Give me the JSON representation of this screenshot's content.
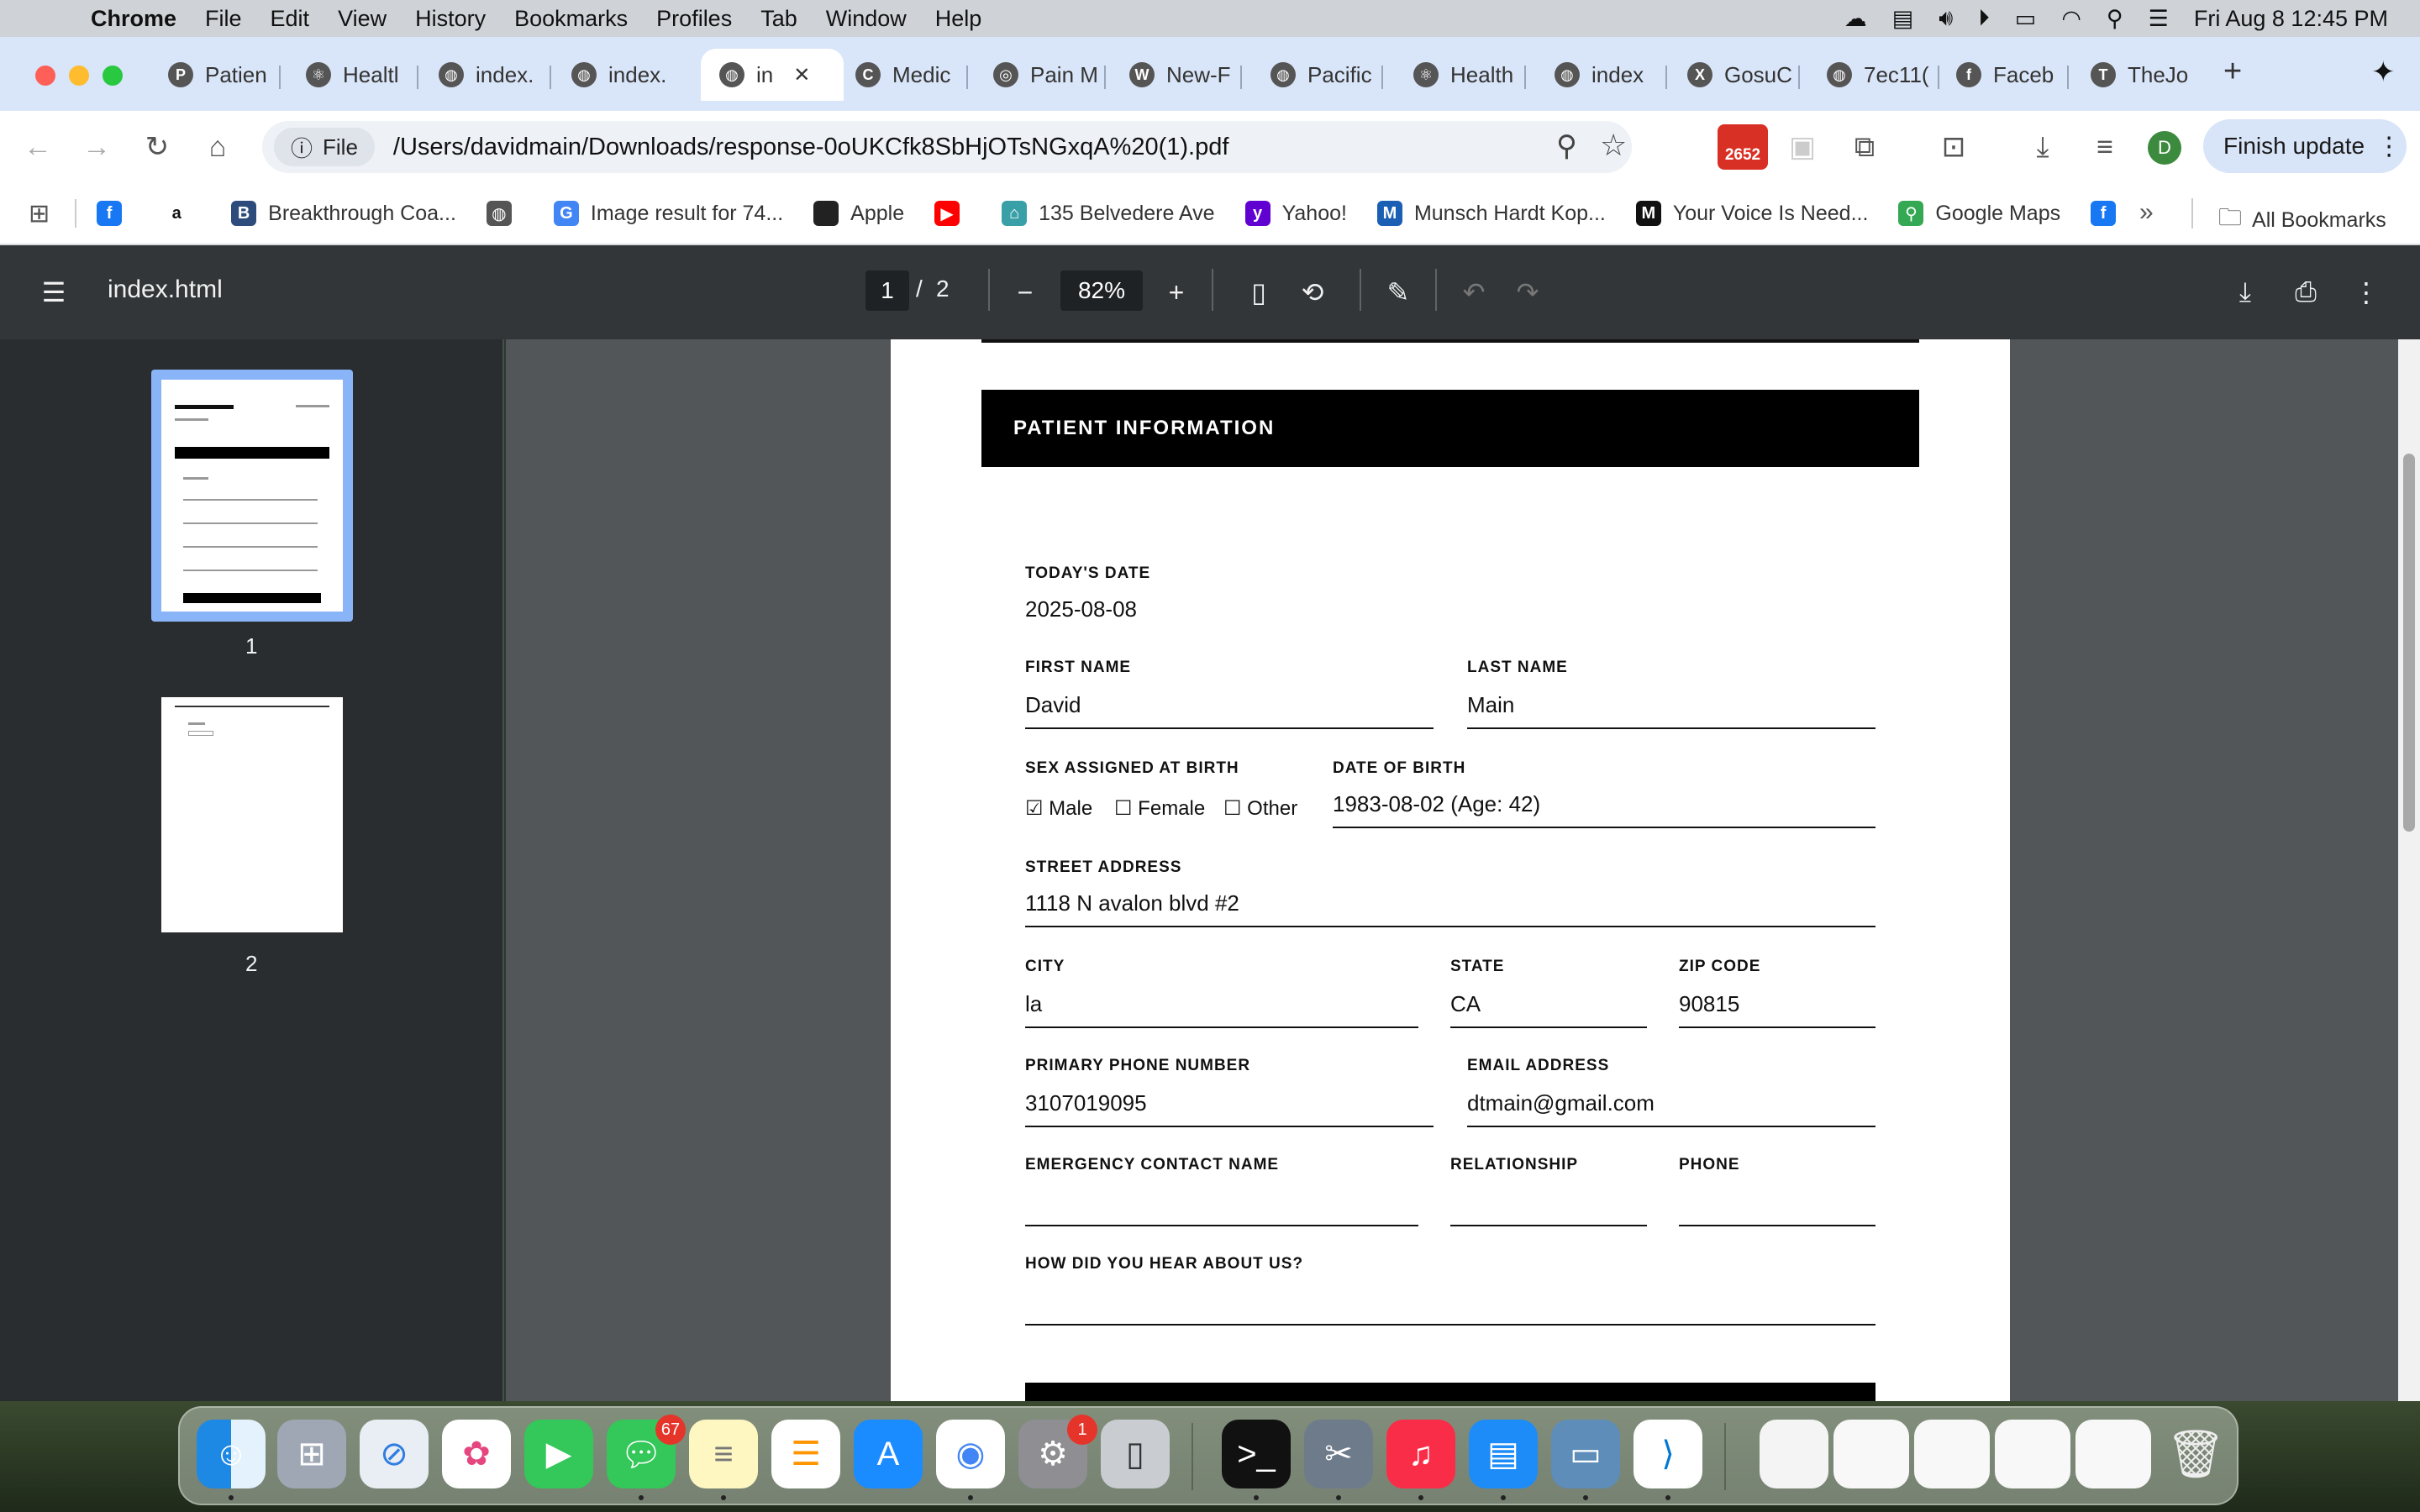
{
  "menubar": {
    "app": "Chrome",
    "items": [
      "File",
      "Edit",
      "View",
      "History",
      "Bookmarks",
      "Profiles",
      "Tab",
      "Window",
      "Help"
    ],
    "datetime": "Fri Aug 8  12:45 PM"
  },
  "tabs": [
    {
      "label": "Patien",
      "icon": "P"
    },
    {
      "label": "Healtl",
      "icon": "⚛"
    },
    {
      "label": "index.",
      "icon": "◍"
    },
    {
      "label": "index.",
      "icon": "◍"
    },
    {
      "label": "in",
      "icon": "◍",
      "active": true
    },
    {
      "label": "Medic",
      "icon": "C"
    },
    {
      "label": "Pain M",
      "icon": "◎"
    },
    {
      "label": "New-F",
      "icon": "W"
    },
    {
      "label": "Pacific",
      "icon": "◍"
    },
    {
      "label": "Health",
      "icon": "⚛"
    },
    {
      "label": "index",
      "icon": "◍"
    },
    {
      "label": "GosuC",
      "icon": "X"
    },
    {
      "label": "7ec11(",
      "icon": "◍"
    },
    {
      "label": "Faceb",
      "icon": "f"
    },
    {
      "label": "TheJo",
      "icon": "T"
    }
  ],
  "toolbar": {
    "file_chip": "File",
    "url": "/Users/davidmain/Downloads/response-0oUKCfk8SbHjOTsNGxqA%20(1).pdf",
    "badge_count": "2652",
    "profile_initial": "D",
    "finish_update": "Finish update"
  },
  "bookmarks": [
    {
      "label": "",
      "icon": "f",
      "color": "#1877f2"
    },
    {
      "label": "",
      "icon": "a",
      "color": "#ffffff"
    },
    {
      "label": "Breakthrough Coa...",
      "icon": "B",
      "color": "#2d4c7c"
    },
    {
      "label": "",
      "icon": "◍",
      "color": "#555555"
    },
    {
      "label": "Image result for 74...",
      "icon": "G",
      "color": "#4285f4"
    },
    {
      "label": "Apple",
      "icon": "",
      "color": "#222222"
    },
    {
      "label": "",
      "icon": "▶",
      "color": "#ff0000"
    },
    {
      "label": "135 Belvedere Ave",
      "icon": "⌂",
      "color": "#3aa0a8"
    },
    {
      "label": "Yahoo!",
      "icon": "y",
      "color": "#6001d2"
    },
    {
      "label": "Munsch Hardt Kop...",
      "icon": "M",
      "color": "#1a5fb4"
    },
    {
      "label": "Your Voice Is Need...",
      "icon": "M",
      "color": "#111111"
    },
    {
      "label": "Google Maps",
      "icon": "⚲",
      "color": "#34a853"
    },
    {
      "label": "",
      "icon": "f",
      "color": "#1877f2"
    }
  ],
  "all_bookmarks": "All Bookmarks",
  "pdf": {
    "title": "index.html",
    "page_current": "1",
    "page_total": "2",
    "zoom": "82%",
    "thumb_labels": [
      "1",
      "2"
    ]
  },
  "form": {
    "section_title": "PATIENT INFORMATION",
    "todays_date_label": "TODAY'S DATE",
    "todays_date": "2025-08-08",
    "first_name_label": "FIRST NAME",
    "first_name": "David",
    "last_name_label": "LAST NAME",
    "last_name": "Main",
    "sex_label": "SEX ASSIGNED AT BIRTH",
    "sex_male": "☑ Male",
    "sex_female": "☐ Female",
    "sex_other": "☐ Other",
    "dob_label": "DATE OF BIRTH",
    "dob": "1983-08-02 (Age: 42)",
    "street_label": "STREET ADDRESS",
    "street": "1118 N avalon blvd #2",
    "city_label": "CITY",
    "city": "la",
    "state_label": "STATE",
    "state": "CA",
    "zip_label": "ZIP CODE",
    "zip": "90815",
    "phone_label": "PRIMARY PHONE NUMBER",
    "phone": "3107019095",
    "email_label": "EMAIL ADDRESS",
    "email": "dtmain@gmail.com",
    "emergency_label": "EMERGENCY CONTACT NAME",
    "relationship_label": "RELATIONSHIP",
    "ephone_label": "PHONE",
    "hear_label": "HOW DID YOU HEAR ABOUT US?"
  },
  "dock": {
    "messages_badge": "67",
    "settings_badge": "1"
  }
}
